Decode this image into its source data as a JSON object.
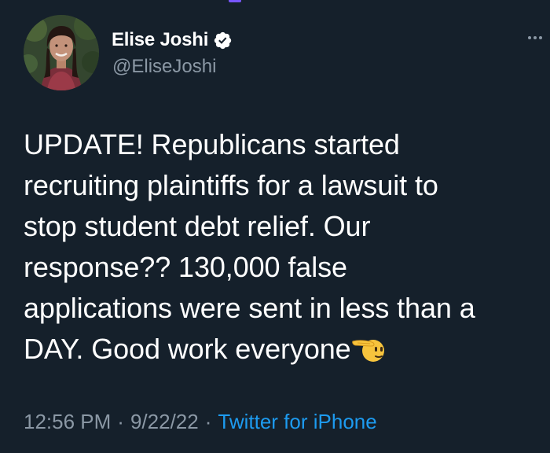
{
  "author": {
    "display_name": "Elise Joshi",
    "handle": "@EliseJoshi",
    "verified": true,
    "avatar_icon": "profile-photo"
  },
  "tweet": {
    "text_lines": [
      "UPDATE! Republicans started",
      "recruiting plaintiffs for a lawsuit to",
      "stop student debt relief. Our",
      "response?? 130,000 false",
      "applications were sent in less than a",
      "DAY. Good work everyone"
    ],
    "trailing_emoji": "saluting-face"
  },
  "meta": {
    "time": "12:56 PM",
    "separator": "·",
    "date": "9/22/22",
    "source": "Twitter for iPhone"
  },
  "colors": {
    "background": "#15202b",
    "secondary_text": "#8b98a5",
    "accent_link": "#1d9bf0",
    "verified_badge": "#ffffff"
  },
  "icons": {
    "verified": "verified-badge-icon",
    "more": "more-options-icon",
    "emoji": "saluting-face-emoji"
  }
}
